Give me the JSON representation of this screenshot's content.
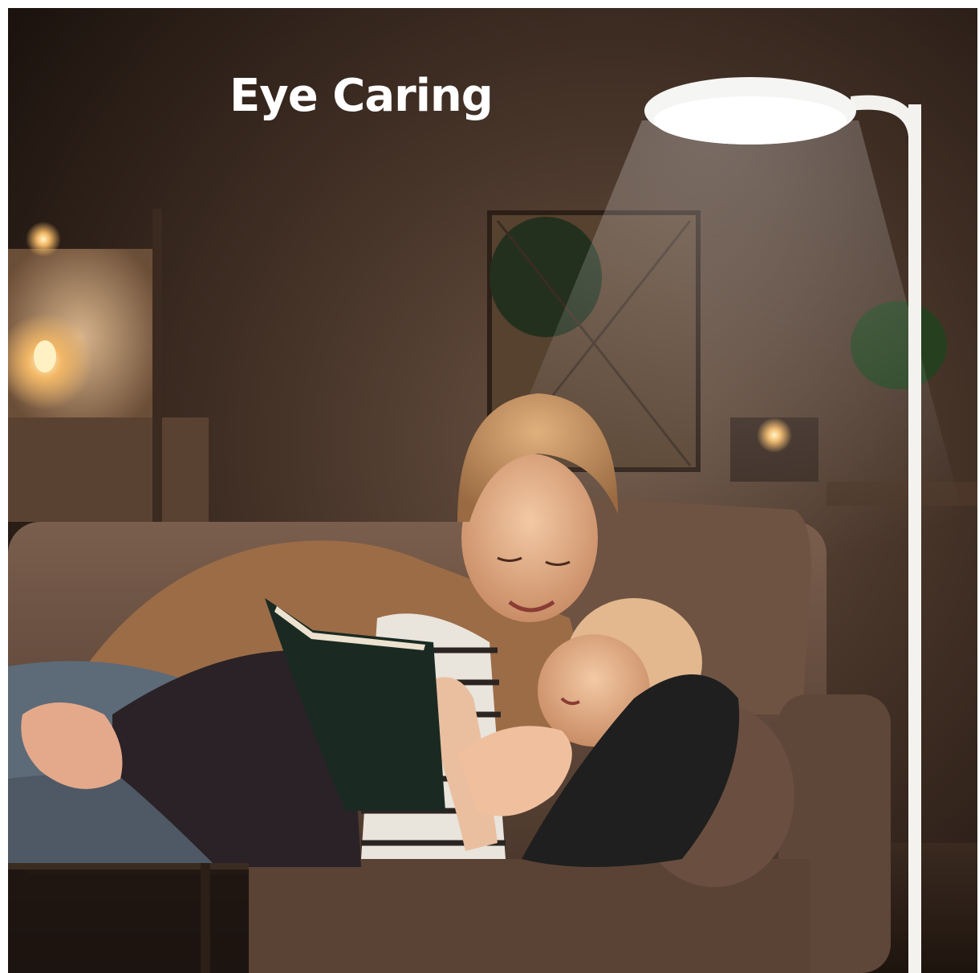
{
  "headline": "Eye Caring",
  "colors": {
    "background_dark": "#2a1d16",
    "wall_warm": "#4a372b",
    "sofa": "#6b5244",
    "lamp_white": "#f5f5f3",
    "headline_text": "#ffffff"
  }
}
